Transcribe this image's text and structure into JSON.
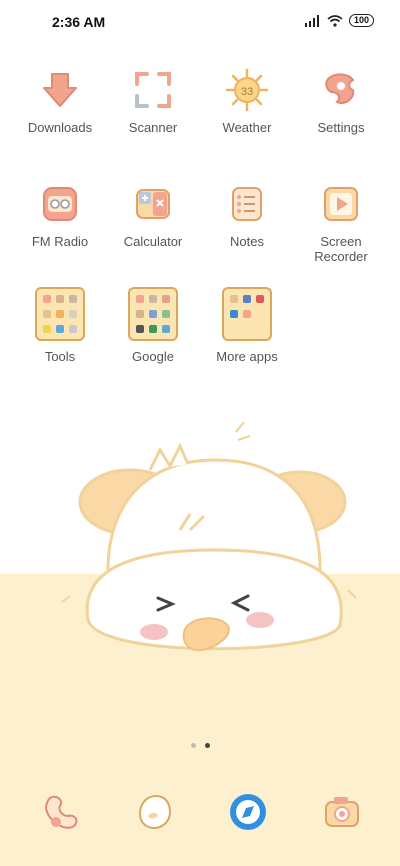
{
  "status_bar": {
    "time": "2:36 AM",
    "battery": "100"
  },
  "apps": [
    {
      "label": "Downloads",
      "icon": "download-arrow-icon"
    },
    {
      "label": "Scanner",
      "icon": "scanner-frame-icon"
    },
    {
      "label": "Weather",
      "icon": "sun-icon",
      "badge": "33"
    },
    {
      "label": "Settings",
      "icon": "settings-icon"
    },
    {
      "label": "FM Radio",
      "icon": "radio-icon"
    },
    {
      "label": "Calculator",
      "icon": "calculator-icon"
    },
    {
      "label": "Notes",
      "icon": "notes-icon"
    },
    {
      "label": "Screen Recorder",
      "label_line1": "Screen",
      "label_line2": "Recorder",
      "icon": "screen-recorder-icon"
    }
  ],
  "folders": [
    {
      "label": "Tools"
    },
    {
      "label": "Google"
    },
    {
      "label": "More apps"
    }
  ],
  "pager": {
    "pages": 2,
    "active": 2
  },
  "dock": [
    {
      "icon": "phone-icon"
    },
    {
      "icon": "messages-icon"
    },
    {
      "icon": "browser-icon"
    },
    {
      "icon": "camera-icon"
    }
  ],
  "colors": {
    "accent": "#f2a48f",
    "folder": "#fbe5b2",
    "background_bottom": "#fdf0cf"
  }
}
